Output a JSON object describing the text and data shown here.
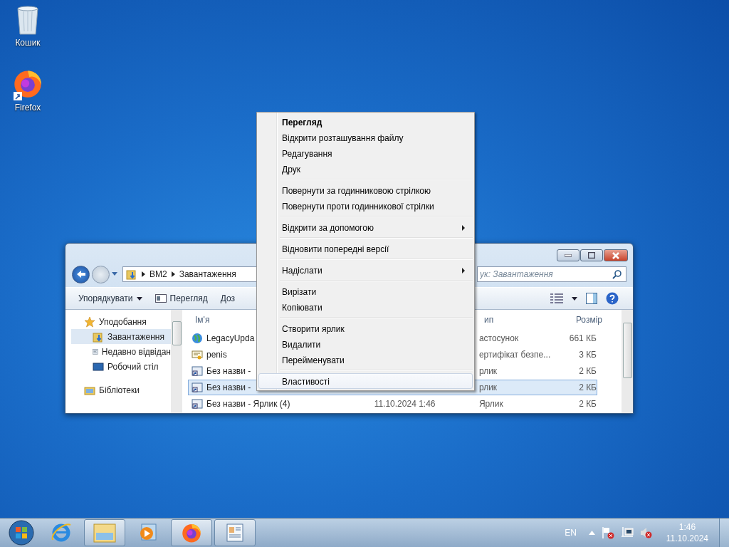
{
  "desktop_icons": [
    {
      "label": "Кошик",
      "kind": "recycle-bin"
    },
    {
      "label": "Firefox",
      "kind": "firefox"
    }
  ],
  "explorer": {
    "address": [
      "ВМ2",
      "Завантаження"
    ],
    "search": {
      "placeholder": "ук: Завантаження"
    },
    "toolbar": [
      {
        "label": "Упорядкувати",
        "kind": "dropdown"
      },
      {
        "label": "Перегляд",
        "kind": "preview"
      },
      {
        "label": "Доз",
        "kind": "plain"
      }
    ],
    "sidebar": {
      "items": [
        {
          "label": "Уподобання",
          "kind": "favorites",
          "selected": false
        },
        {
          "label": "Завантаження",
          "kind": "downloads",
          "selected": true
        },
        {
          "label": "Недавно відвідан",
          "kind": "recent",
          "selected": false
        },
        {
          "label": "Робочий стіл",
          "kind": "desktop",
          "selected": false
        },
        {
          "label": "Бібліотеки",
          "kind": "libraries",
          "selected": false
        }
      ]
    },
    "columns": {
      "name": "Ім'я",
      "type": "ип",
      "size": "Розмір"
    },
    "rows": [
      {
        "name": "LegacyUpda",
        "type": "астосунок",
        "size": "661 КБ",
        "kind": "globe",
        "selected": false
      },
      {
        "name": "penis",
        "type": "ертифікат безпе...",
        "size": "3 КБ",
        "kind": "certificate",
        "selected": false
      },
      {
        "name": "Без назви -",
        "type": "рлик",
        "size": "2 КБ",
        "kind": "shortcut",
        "selected": false
      },
      {
        "name": "Без назви -",
        "type": "рлик",
        "size": "2 КБ",
        "kind": "shortcut",
        "selected": true
      },
      {
        "name": "Без назви - Ярлик (4)",
        "date": "11.10.2024 1:46",
        "type": "Ярлик",
        "size": "2 КБ",
        "kind": "shortcut",
        "selected": false
      }
    ]
  },
  "menu": {
    "items": [
      {
        "kind": "item",
        "label": "Перегляд",
        "default": true,
        "submenu": false,
        "selected": false
      },
      {
        "kind": "item",
        "label": "Відкрити розташування файлу",
        "default": false,
        "submenu": false,
        "selected": false
      },
      {
        "kind": "item",
        "label": "Редагування",
        "default": false,
        "submenu": false,
        "selected": false
      },
      {
        "kind": "item",
        "label": "Друк",
        "default": false,
        "submenu": false,
        "selected": false
      },
      {
        "kind": "separator"
      },
      {
        "kind": "item",
        "label": "Повернути за годинниковою стрілкою",
        "default": false,
        "submenu": false,
        "selected": false
      },
      {
        "kind": "item",
        "label": "Повернути проти годинникової стрілки",
        "default": false,
        "submenu": false,
        "selected": false
      },
      {
        "kind": "separator"
      },
      {
        "kind": "item",
        "label": "Відкрити за допомогою",
        "default": false,
        "submenu": true,
        "selected": false
      },
      {
        "kind": "separator"
      },
      {
        "kind": "item",
        "label": "Відновити попередні версії",
        "default": false,
        "submenu": false,
        "selected": false
      },
      {
        "kind": "separator"
      },
      {
        "kind": "item",
        "label": "Надіслати",
        "default": false,
        "submenu": true,
        "selected": false
      },
      {
        "kind": "separator"
      },
      {
        "kind": "item",
        "label": "Вирізати",
        "default": false,
        "submenu": false,
        "selected": false
      },
      {
        "kind": "item",
        "label": "Копіювати",
        "default": false,
        "submenu": false,
        "selected": false
      },
      {
        "kind": "separator"
      },
      {
        "kind": "item",
        "label": "Створити ярлик",
        "default": false,
        "submenu": false,
        "selected": false
      },
      {
        "kind": "item",
        "label": "Видалити",
        "default": false,
        "submenu": false,
        "selected": false
      },
      {
        "kind": "item",
        "label": "Перейменувати",
        "default": false,
        "submenu": false,
        "selected": false
      },
      {
        "kind": "separator"
      },
      {
        "kind": "item",
        "label": "Властивості",
        "default": false,
        "submenu": false,
        "selected": true
      }
    ]
  },
  "taskbar": {
    "buttons": [
      {
        "kind": "start",
        "running": false
      },
      {
        "kind": "browser",
        "running": false
      },
      {
        "kind": "folder",
        "running": true
      },
      {
        "kind": "media",
        "running": false
      },
      {
        "kind": "firefox",
        "running": true
      },
      {
        "kind": "document",
        "running": true
      }
    ],
    "language": "EN",
    "time": "1:46",
    "date": "11.10.2024"
  }
}
